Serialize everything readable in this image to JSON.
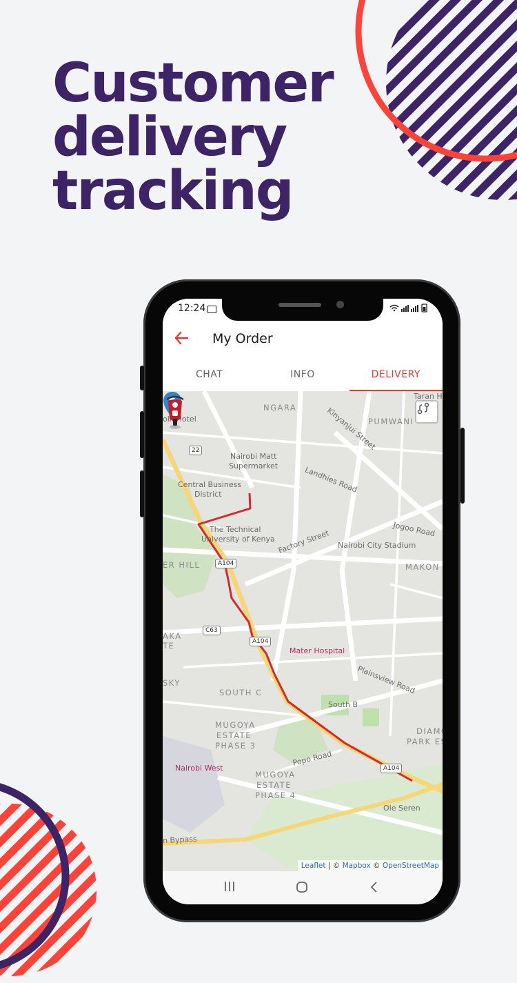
{
  "headline": {
    "line1": "Customer",
    "line2": "delivery",
    "line3": "tracking"
  },
  "colors": {
    "headline": "#3d2466",
    "accent": "#e53935",
    "route": "#d42a2a",
    "deco_stripe": "#3d2466",
    "deco_red": "#ff4338"
  },
  "status_bar": {
    "time": "12:24",
    "icons": "wifi-icon signal-icon battery-icon"
  },
  "appbar": {
    "back_icon": "arrow-left-icon",
    "title": "My Order"
  },
  "tabs": [
    {
      "label": "CHAT",
      "active": false
    },
    {
      "label": "INFO",
      "active": false
    },
    {
      "label": "DELIVERY",
      "active": true
    }
  ],
  "map": {
    "labels": {
      "ngara": "NGARA",
      "pumwani": "PUMWANI",
      "taran": "Taran H",
      "hotel": "olk Hotel",
      "kinyanjui": "Kinyanjui Street",
      "matt1": "Nairobi Matt",
      "matt2": "Supermarket",
      "cbd1": "Central Business",
      "cbd2": "District",
      "landhies": "Landhies Road",
      "tuk1": "The Technical",
      "tuk2": "University of Kenya",
      "factory": "Factory Street",
      "jogoo": "Jogoo Road",
      "stadium": "Nairobi City Stadium",
      "erhill": "ER HILL",
      "makon": "MAKON",
      "aka": "AKA",
      "te": "TE",
      "mater": "Mater Hospital",
      "plainsview": "Plainsview Road",
      "sky": "SKY",
      "southc": "SOUTH C",
      "southb": "South B",
      "mugoya1a": "MUGOYA",
      "mugoya1b": "ESTATE",
      "mugoya1c": "PHASE 3",
      "diamo": "DIAMO",
      "parkes": "PARK ES",
      "popo": "Popo Road",
      "nbwest": "Nairobi West",
      "mugoya2a": "MUGOYA",
      "mugoya2b": "ESTATE",
      "mugoya2c": "PHASE 4",
      "oleseren": "Ole Seren",
      "bypass": "n Bypass"
    },
    "road_badges": {
      "r22": "22",
      "a104a": "A104",
      "c63": "C63",
      "a104b": "A104",
      "a104c": "A104"
    },
    "attribution": {
      "leaflet": "Leaflet",
      "sep": " | © ",
      "mapbox": "Mapbox",
      "osm_prefix": " © ",
      "osm": "OpenStreetMap"
    },
    "layers_icon": "route-layers-icon",
    "destination_icon": "location-pin-icon",
    "rider_icon": "delivery-scooter-icon"
  },
  "navbar": {
    "recent": "|||",
    "home": "○",
    "back": "‹"
  }
}
